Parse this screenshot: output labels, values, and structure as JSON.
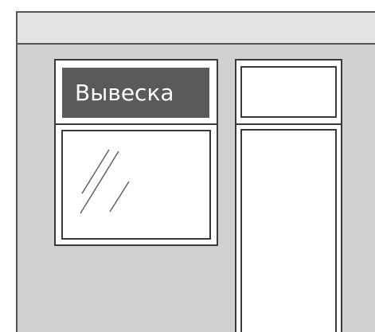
{
  "storefront": {
    "sign_text": "Вывеска"
  },
  "colors": {
    "wall": "#d1d1d1",
    "awning": "#e4e4e4",
    "sign_background": "#5a5a5a",
    "sign_text": "#ffffff",
    "frame": "#3a3a3a",
    "glass": "#ffffff"
  },
  "icons": {
    "glass_reflection": "glass-reflection-icon"
  }
}
